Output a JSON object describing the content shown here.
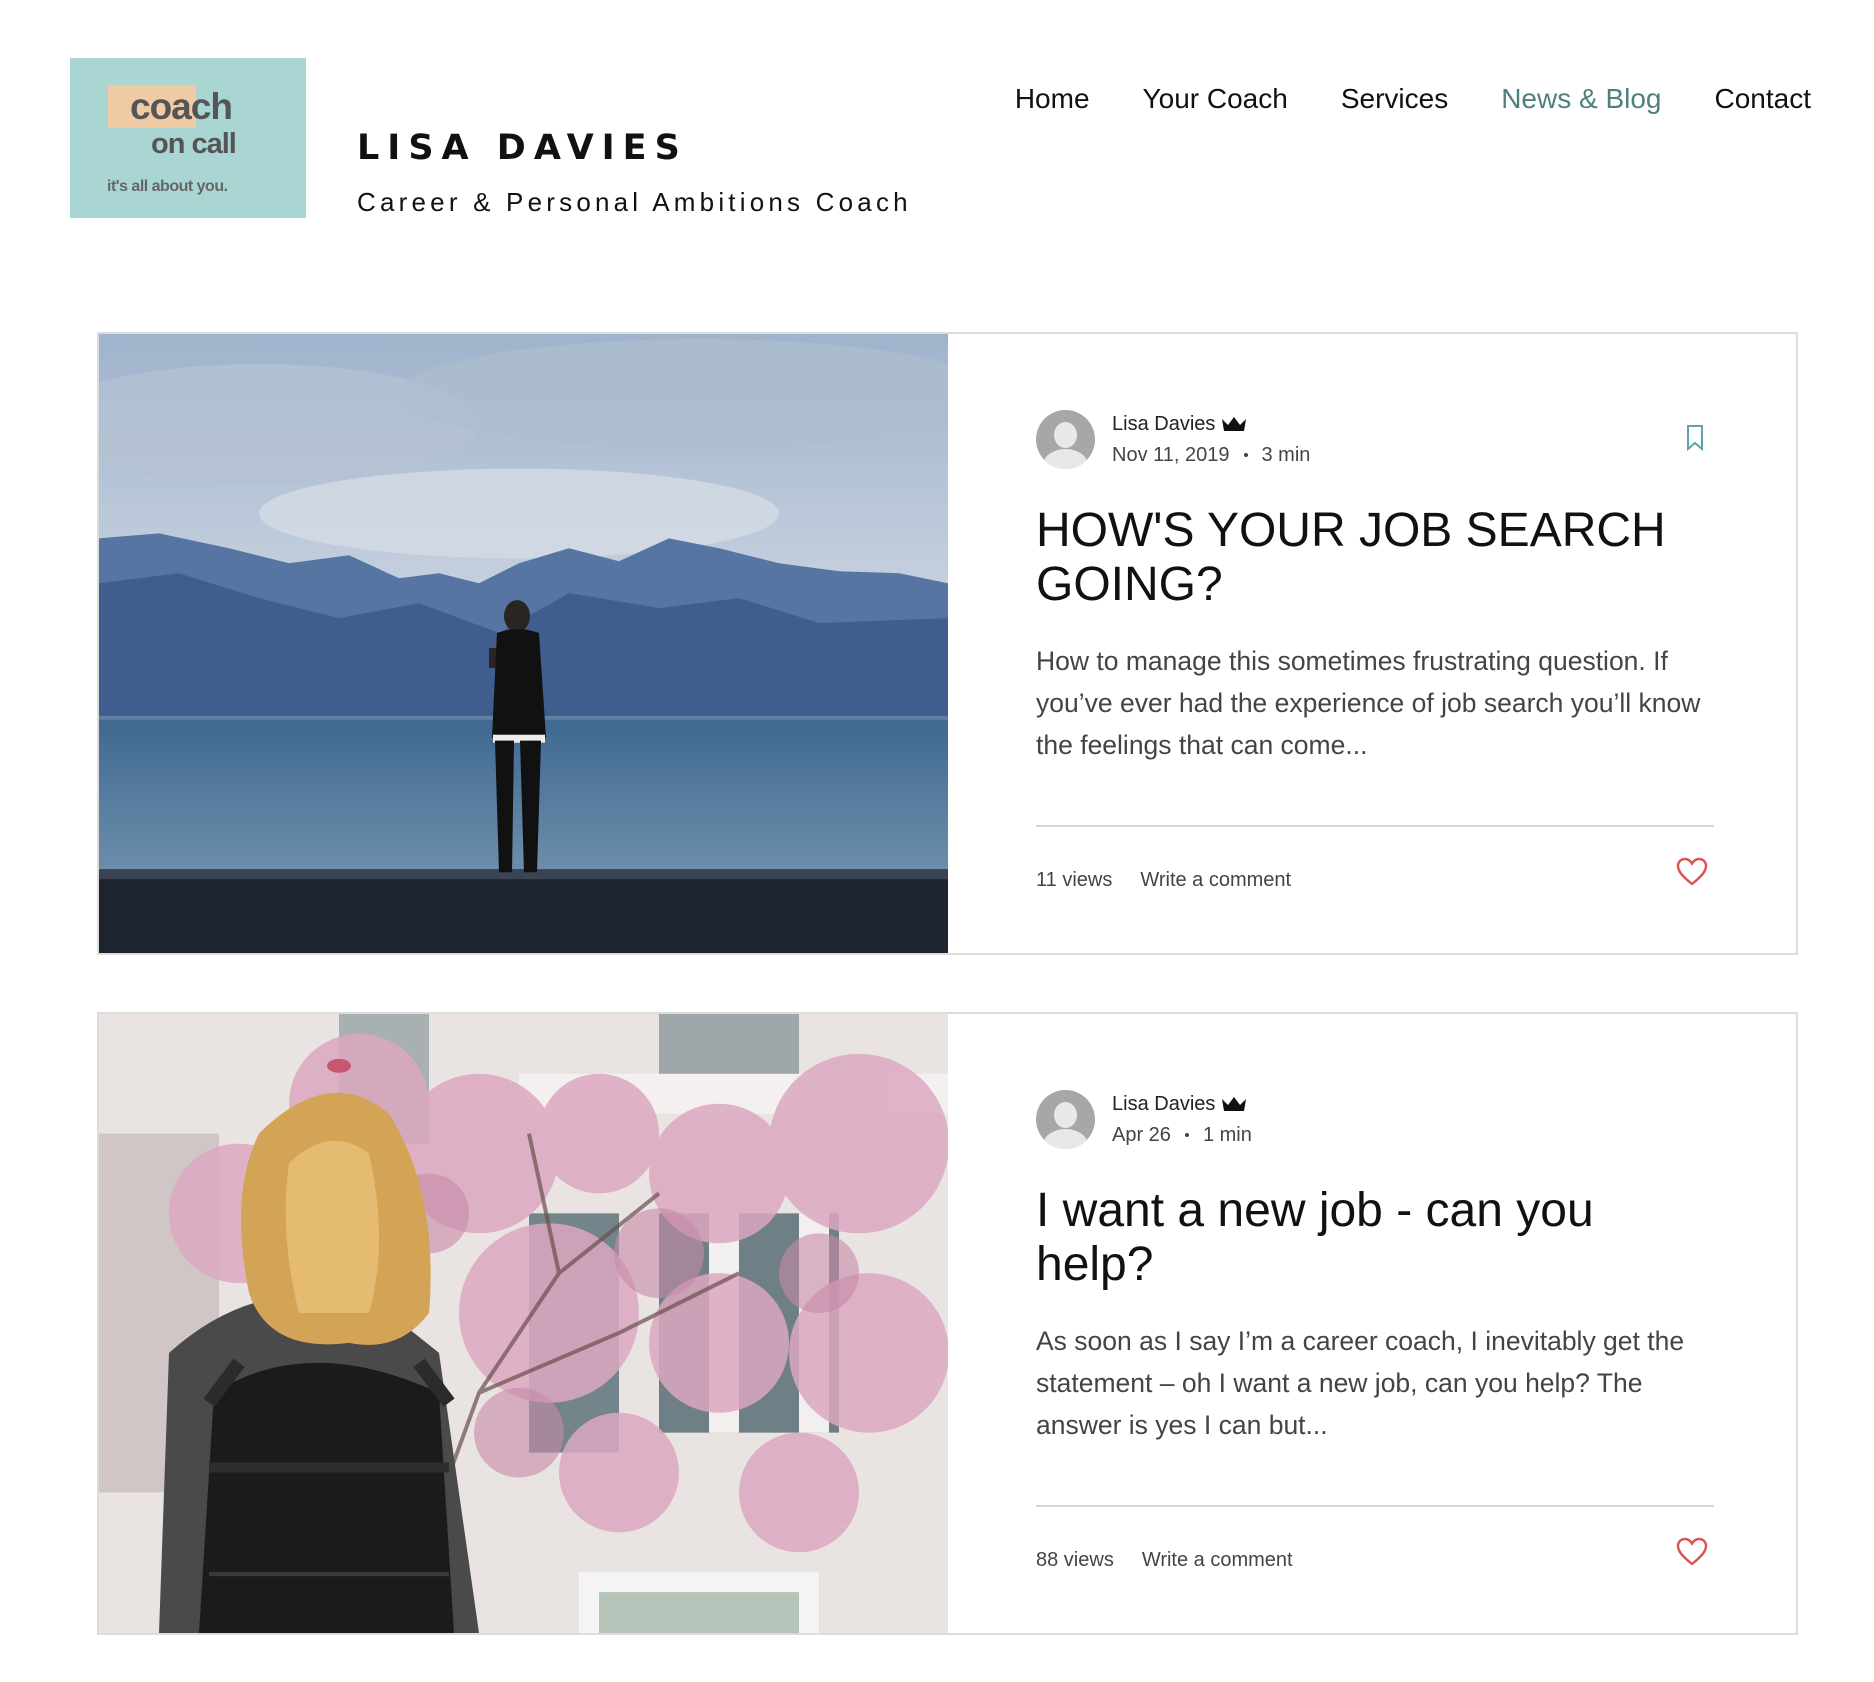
{
  "logo": {
    "word1": "coach",
    "word2": "on call",
    "tagline": "it's all about you."
  },
  "brand": {
    "name": "LISA DAVIES",
    "subtitle": "Career & Personal Ambitions Coach"
  },
  "nav": {
    "items": [
      {
        "label": "Home",
        "active": false
      },
      {
        "label": "Your Coach",
        "active": false
      },
      {
        "label": "Services",
        "active": false
      },
      {
        "label": "News & Blog",
        "active": true
      },
      {
        "label": "Contact",
        "active": false
      }
    ]
  },
  "colors": {
    "logo_bg": "#a9d6d3",
    "logo_highlight": "#f0c9a5",
    "nav_active": "#4f8080",
    "heart": "#d9534f",
    "bookmark": "#5aa3a8"
  },
  "posts": [
    {
      "image": "man-standing-by-lake-mountains",
      "author": "Lisa Davies",
      "author_badge": "crown-icon",
      "date": "Nov 11, 2019",
      "read_time": "3 min",
      "title": "HOW'S YOUR JOB SEARCH GOING?",
      "excerpt": "How to manage this sometimes frustrating question. If you’ve ever had the experience of job search you’ll know the feelings that can come...",
      "views": "11 views",
      "comment_label": "Write a comment",
      "has_bookmark": true
    },
    {
      "image": "woman-with-backpack-cherry-blossoms",
      "author": "Lisa Davies",
      "author_badge": "crown-icon",
      "date": "Apr 26",
      "read_time": "1 min",
      "title": "I want a new job - can you help?",
      "excerpt": "As soon as I say I’m a career coach, I inevitably get the statement – oh I want a new job, can you help? The answer is yes I can but...",
      "views": "88 views",
      "comment_label": "Write a comment",
      "has_bookmark": false
    }
  ]
}
